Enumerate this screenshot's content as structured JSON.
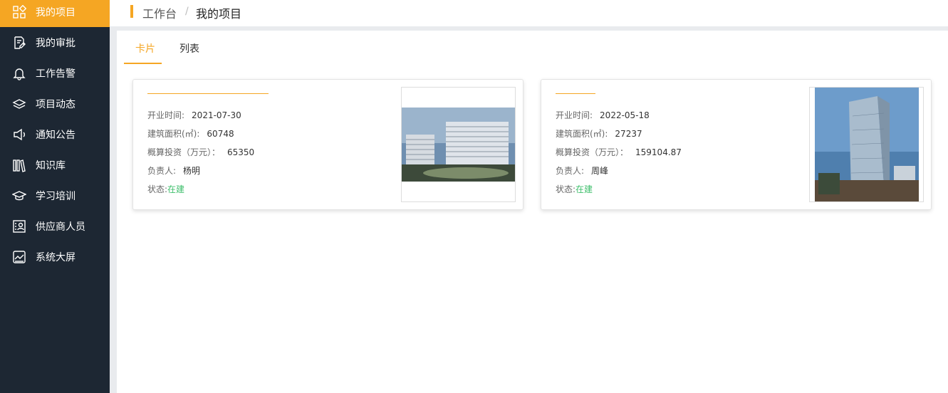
{
  "sidebar": {
    "items": [
      {
        "label": "我的项目",
        "icon": "grid-icon",
        "active": true
      },
      {
        "label": "我的审批",
        "icon": "approval-doc-icon",
        "active": false
      },
      {
        "label": "工作告警",
        "icon": "bell-icon",
        "active": false
      },
      {
        "label": "项目动态",
        "icon": "layers-icon",
        "active": false
      },
      {
        "label": "通知公告",
        "icon": "megaphone-icon",
        "active": false
      },
      {
        "label": "知识库",
        "icon": "books-icon",
        "active": false
      },
      {
        "label": "学习培训",
        "icon": "graduation-cap-icon",
        "active": false
      },
      {
        "label": "供应商人员",
        "icon": "contact-card-icon",
        "active": false
      },
      {
        "label": "系统大屏",
        "icon": "chart-screen-icon",
        "active": false
      }
    ]
  },
  "breadcrumb": {
    "root": "工作台",
    "separator": "/",
    "current": "我的项目"
  },
  "tabs": [
    {
      "label": "卡片",
      "active": true
    },
    {
      "label": "列表",
      "active": false
    }
  ],
  "colors": {
    "accent": "#f5a623",
    "sidebar_bg": "#1d2733",
    "status_green": "#3fbf6c"
  },
  "cards": [
    {
      "title": "",
      "open_label": "开业时间:",
      "open_value": "2021-07-30",
      "area_label": "建筑面积(㎡):",
      "area_value": "60748",
      "invest_label": "概算投资（万元）：",
      "invest_value": "65350",
      "owner_label": "负责人:",
      "owner_value": "杨明",
      "status_label": "状态:",
      "status_value": "在建"
    },
    {
      "title": "",
      "open_label": "开业时间:",
      "open_value": "2022-05-18",
      "area_label": "建筑面积(㎡):",
      "area_value": "27237",
      "invest_label": "概算投资（万元）：",
      "invest_value": "159104.87",
      "owner_label": "负责人:",
      "owner_value": "周峰",
      "status_label": "状态:",
      "status_value": "在建"
    }
  ]
}
